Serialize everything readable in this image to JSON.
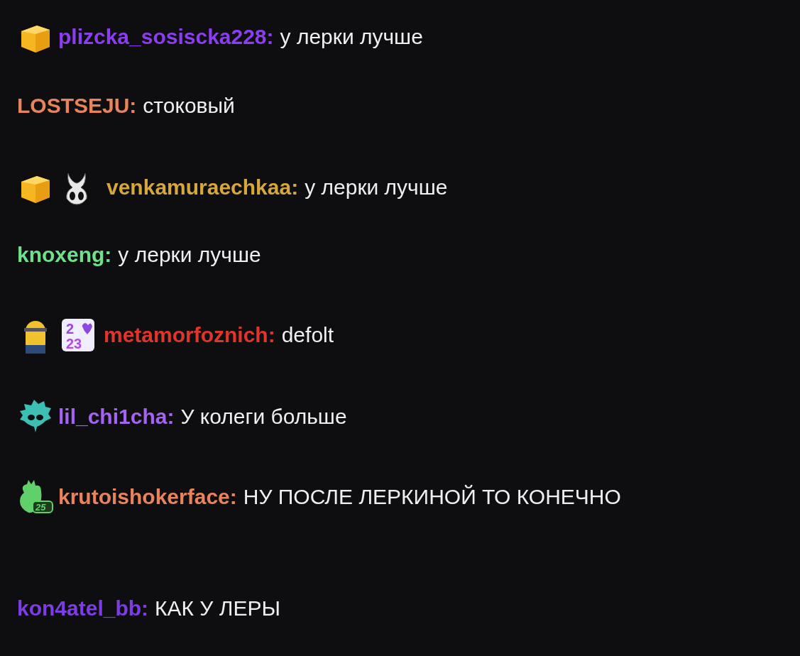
{
  "messages": [
    {
      "badges": [
        {
          "kind": "cube"
        }
      ],
      "user": "plizcka_sosiscka228:",
      "color": "#8b3df0",
      "text": "у лерки лучше"
    },
    {
      "user": "LOSTSEJU:",
      "color": "#e8845c",
      "text": "стоковый"
    },
    {
      "badges": [
        {
          "kind": "cube"
        },
        {
          "kind": "mask"
        }
      ],
      "user": "venkamuraechkaa:",
      "color": "#d6a73c",
      "text": "у лерки лучше"
    },
    {
      "user": "knoxeng:",
      "color": "#6fe08c",
      "text": "у лерки лучше"
    },
    {
      "badges": [
        {
          "kind": "figure"
        },
        {
          "kind": "year",
          "lines": [
            "2",
            "23"
          ]
        }
      ],
      "user": "metamorfoznich:",
      "color": "#e0352b",
      "text": "defolt"
    },
    {
      "badges": [
        {
          "kind": "bird"
        }
      ],
      "user": "lil_chi1cha:",
      "color": "#a463f2",
      "text": "У колеги больше"
    },
    {
      "badges": [
        {
          "kind": "heart",
          "text": "25"
        }
      ],
      "user": "krutoishokerface:",
      "color": "#e8845c",
      "text": "НУ ПОСЛЕ ЛЕРКИНОЙ ТО КОНЕЧНО"
    },
    {
      "user": "kon4atel_bb:",
      "color": "#7c3de6",
      "text": "КАК У ЛЕРЫ"
    }
  ]
}
